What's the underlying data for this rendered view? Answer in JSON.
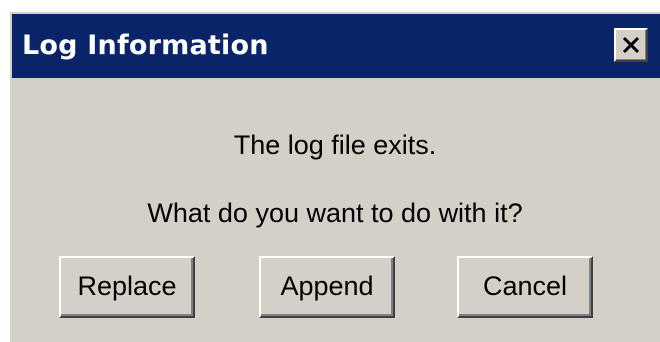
{
  "window": {
    "title": "Log Information",
    "close_icon": "close-icon"
  },
  "message": {
    "line1": "The log file exits.",
    "line2": "What do you want to do with it?"
  },
  "buttons": {
    "replace": "Replace",
    "append": "Append",
    "cancel": "Cancel"
  },
  "colors": {
    "titlebar": "#0a246a",
    "dialog_face": "#d4d0c8",
    "title_text": "#ffffff"
  }
}
